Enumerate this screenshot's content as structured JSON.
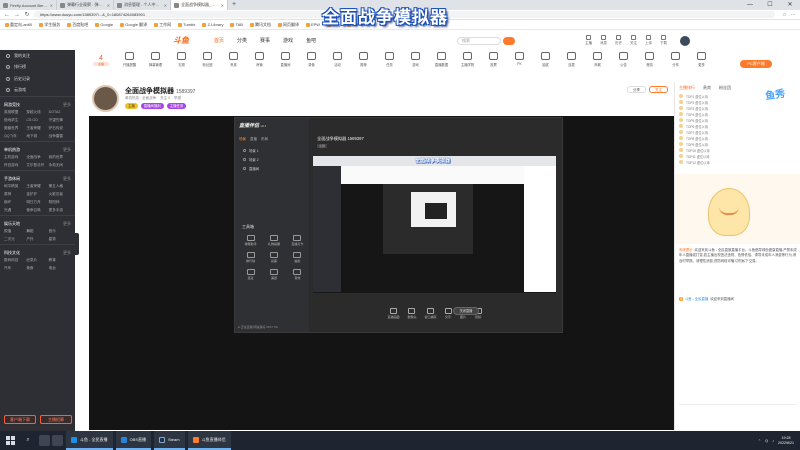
{
  "browser": {
    "tabs": [
      {
        "label": "Firefly Account Berlin Electronics",
        "active": false
      },
      {
        "label": "弹幕行业观察 - 弹幕工具",
        "active": false
      },
      {
        "label": "消息管理 - 个人中心 - 斗鱼",
        "active": false
      },
      {
        "label": "全面战争模拟器_斗鱼直播",
        "active": true
      }
    ],
    "url": "https://www.douyu.com/1589397/...&_0=180874264083901",
    "bookmarks": [
      "重定向-an60",
      "学生服务",
      "百度贴吧",
      "Google",
      "Google 翻译",
      "工作网",
      "Tumblr",
      "Z-Library",
      "TAB",
      "腾讯文档",
      "网页翻译",
      "EPW",
      "今天",
      "GitHub"
    ]
  },
  "overlay_title": "全面战争模拟器",
  "site": {
    "logo": "斗鱼",
    "nav": [
      "首页",
      "分类",
      "赛事",
      "游戏",
      "鱼吧"
    ],
    "search_placeholder": "搜索",
    "header_icons": [
      "主播",
      "消息",
      "历史",
      "关注",
      "上传",
      "下载"
    ],
    "first_badge": {
      "number": "4",
      "label": "主播"
    },
    "categories": [
      "开播提醒",
      "弹幕管理",
      "礼物",
      "粉丝团",
      "贵族",
      "房管",
      "直播间",
      "录像",
      "活动",
      "推荐",
      "任务",
      "游戏",
      "直播数据",
      "主播学院",
      "投票",
      "PK",
      "抽奖",
      "连麦",
      "商城",
      "公告",
      "竞猜",
      "分享",
      "更多"
    ],
    "pc_button": "PC客户端"
  },
  "sidebar": {
    "top_items": [
      "我的关注",
      "排行榜",
      "历史记录",
      "云游戏"
    ],
    "sections": [
      {
        "title": "网游竞技",
        "more": "更多",
        "items": [
          "英雄联盟",
          "穿越火线",
          "DOTA2",
          "绝地求生",
          "CS:GO",
          "守望先锋",
          "魔兽世界",
          "王者荣耀",
          "炉石传说",
          "QQ飞车",
          "地下城",
          "战争雷霆"
        ]
      },
      {
        "title": "单机热游",
        "more": "更多",
        "items": [
          "主机游戏",
          "全面战争",
          "我的世界",
          "怀旧游戏",
          "艾尔登法环",
          "永劫无间"
        ]
      },
      {
        "title": "手游休闲",
        "more": "更多",
        "items": [
          "和平精英",
          "王者荣耀",
          "第五人格",
          "原神",
          "金铲铲",
          "火影忍者",
          "崩坏",
          "明日方舟",
          "阴阳师",
          "光遇",
          "使命召唤",
          "更多手游"
        ]
      },
      {
        "title": "娱乐天地",
        "more": "更多",
        "items": [
          "颜值",
          "舞蹈",
          "音乐",
          "二次元",
          "户外",
          "星秀"
        ]
      },
      {
        "title": "科技文化",
        "more": "更多",
        "items": [
          "数码科技",
          "纪录片",
          "教育",
          "汽车",
          "美食",
          "电台"
        ]
      }
    ],
    "bottom_buttons": [
      "客户端下载",
      "主播招募"
    ]
  },
  "room": {
    "title": "全面战争模拟器",
    "room_id": "1589397",
    "meta": [
      "单机热游 · 全面战争",
      "关注 0",
      "举报"
    ],
    "tags": [
      "主播",
      "直播间福利",
      "主播任务"
    ],
    "actions": [
      "分享",
      "关注"
    ]
  },
  "inner_app": {
    "name": "直播伴侣",
    "version": "v6.1",
    "tabs": [
      "场景",
      "直播",
      "布局"
    ],
    "scenes": [
      "场景 1",
      "场景 2",
      "直播间"
    ],
    "tools_label": "工具箱",
    "tools": [
      "弹幕助手",
      "礼物提醒",
      "直播打卡",
      "排行榜",
      "投票",
      "抽奖",
      "连麦",
      "美颜",
      "音效"
    ],
    "status": "● 正在直播  网速良好  CPU 7%",
    "preview_title": "全面战争模拟器 1589397",
    "preview_sub": "全屏",
    "bottom_tools": [
      "直播画面",
      "摄像头",
      "窗口捕获",
      "文字",
      "图片",
      "音频"
    ],
    "start_button": "关闭直播"
  },
  "chat": {
    "tabs": [
      "主播排行",
      "贵宾",
      "粉丝团"
    ],
    "rank_rows": [
      "TOP1 虚位以待",
      "TOP2 虚位以待",
      "TOP3 虚位以待",
      "TOP4 虚位以待",
      "TOP5 虚位以待",
      "TOP6 虚位以待",
      "TOP7 虚位以待",
      "TOP8 虚位以待",
      "TOP9 虚位以待",
      "TOP10 虚位以待",
      "TOP11 虚位以待",
      "TOP12 虚位以待"
    ],
    "logo": "鱼秀",
    "system_name": "系统提示:",
    "system_msg": "欢迎来到斗鱼 - 全民直娱直播平台。斗鱼倡导绿色健康直播,严禁未成年人直播或打赏,若主播出现违法违规、色情低俗、诱导未成年人消费等行为,请及时举报。请理性消费,谨防网络诈骗,切勿私下交易。",
    "user_msg_level": "3",
    "user_msg_name": "斗鱼 - 全民直播",
    "user_msg_text": "欢迎来到直播间"
  },
  "taskbar": {
    "tasks": [
      {
        "label": "斗鱼 - 全民直播",
        "cls": "edge"
      },
      {
        "label": "OBS直播",
        "cls": "ide"
      },
      {
        "label": "Steam",
        "cls": "steam"
      },
      {
        "label": "斗鱼直播伴侣",
        "cls": ""
      }
    ],
    "time": "19:28",
    "date": "2022/8/21"
  },
  "colors": {
    "accent": "#ff6a13",
    "sidebar_bg": "#2d2f35",
    "player_bg": "#141414"
  }
}
